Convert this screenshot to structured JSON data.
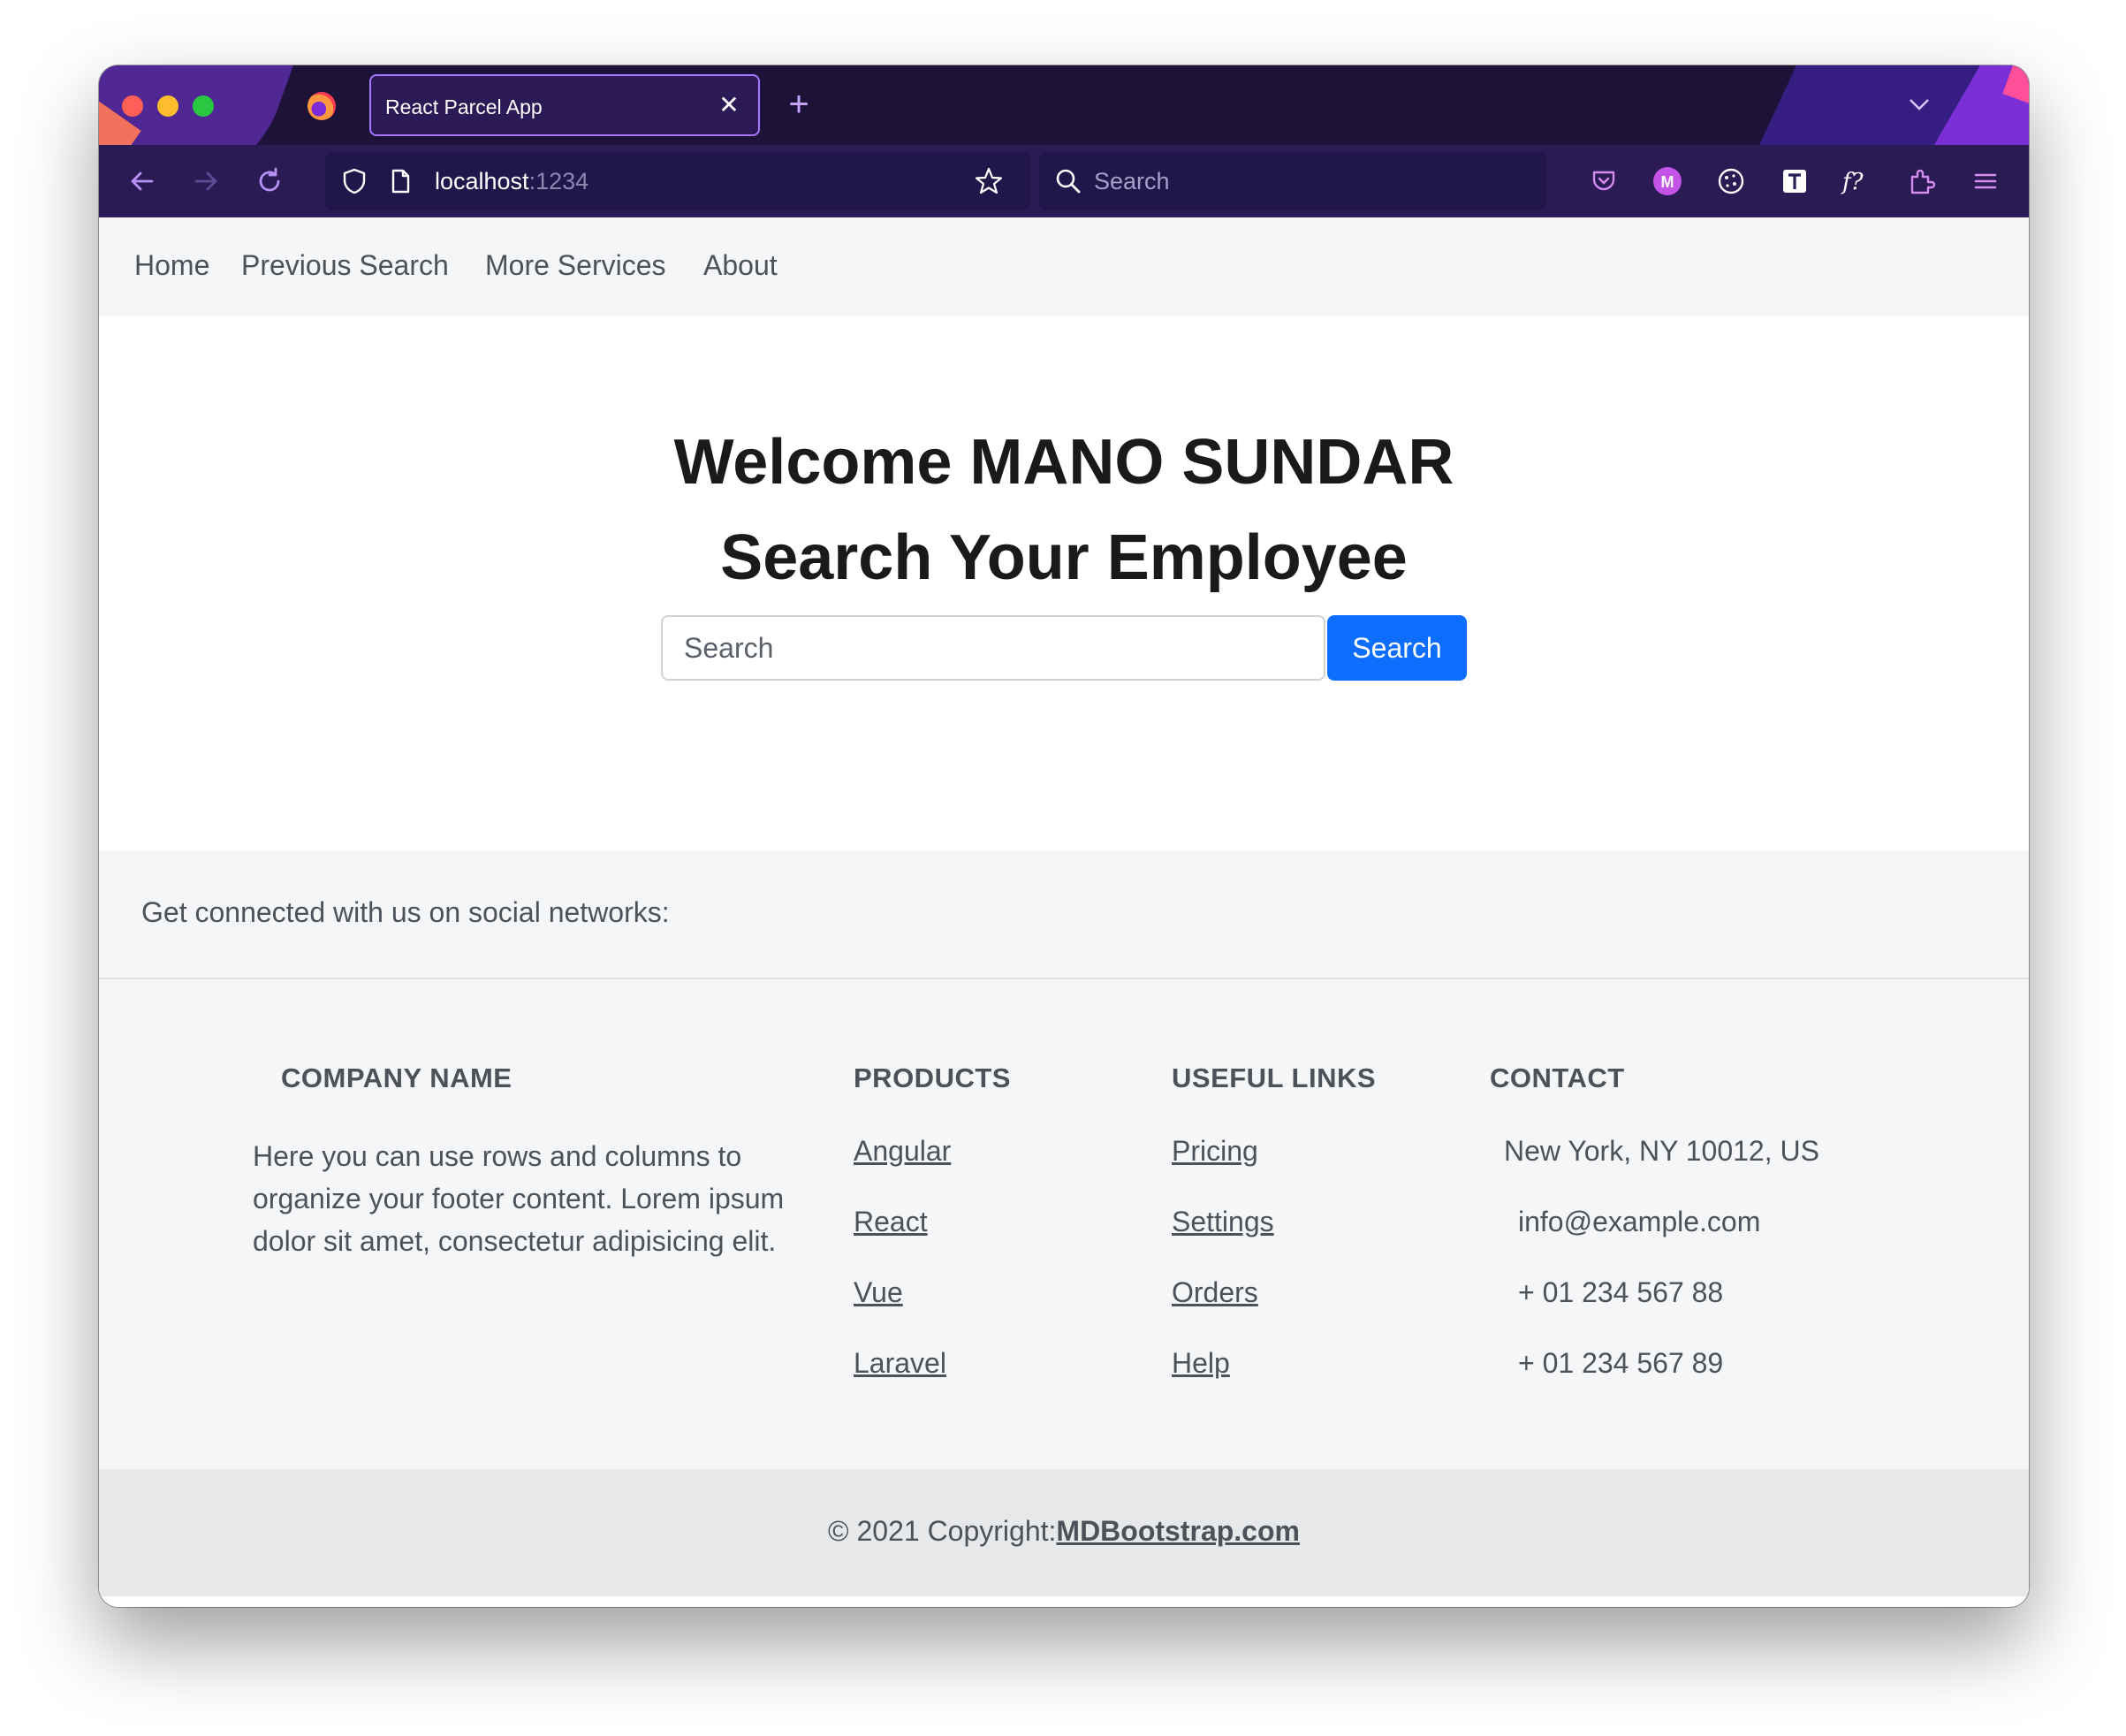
{
  "browser": {
    "tab_title": "React Parcel App",
    "tab_close": "✕",
    "new_tab": "+",
    "url_host": "localhost",
    "url_port": ":1234",
    "search_placeholder": "Search"
  },
  "nav": {
    "items": [
      "Home",
      "Previous Search",
      "More Services",
      "About"
    ]
  },
  "hero": {
    "welcome": "Welcome MANO SUNDAR",
    "subtitle": "Search Your Employee",
    "search_placeholder": "Search",
    "search_button": "Search"
  },
  "footer": {
    "social_text": "Get connected with us on social networks:",
    "company": {
      "heading": "COMPANY NAME",
      "text": "Here you can use rows and columns to organize your footer content. Lorem ipsum dolor sit amet, consectetur adipisicing elit."
    },
    "products": {
      "heading": "PRODUCTS",
      "links": [
        "Angular",
        "React",
        "Vue",
        "Laravel"
      ]
    },
    "useful_links": {
      "heading": "USEFUL LINKS",
      "links": [
        "Pricing",
        "Settings",
        "Orders",
        "Help"
      ]
    },
    "contact": {
      "heading": "CONTACT",
      "items": [
        "New York, NY 10012, US",
        "info@example.com",
        "+ 01 234 567 88",
        "+ 01 234 567 89"
      ]
    },
    "copyright_prefix": "© 2021 Copyright:",
    "copyright_link": "MDBootstrap.com"
  },
  "colors": {
    "browser_chrome": "#2a1b55",
    "primary_button": "#0d6efd",
    "footer_bg": "#f5f6f8",
    "copyright_bg": "#e7e8ea"
  }
}
